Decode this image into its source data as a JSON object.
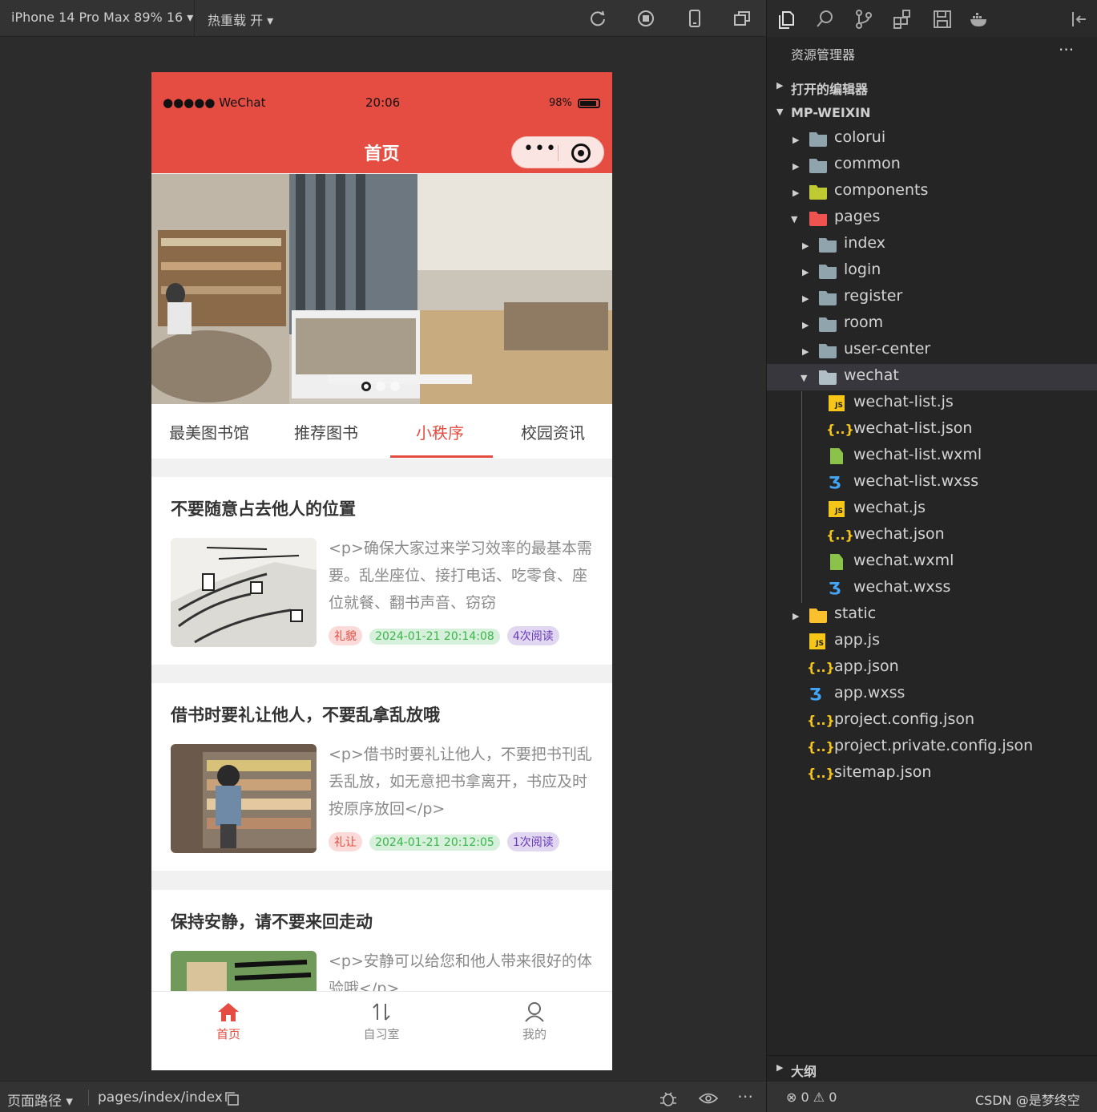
{
  "toolbar": {
    "device": "iPhone 14 Pro Max 89% 16 ▾",
    "hot_reload": "热重载 开 ▾"
  },
  "phone": {
    "status": {
      "signal": "●●●●● WeChat",
      "time": "20:06",
      "battery": "98%"
    },
    "nav_title": "首页",
    "capsule_dots": "•••",
    "tabs": [
      {
        "label": "最美图书馆"
      },
      {
        "label": "推荐图书"
      },
      {
        "label": "小秩序",
        "active": true
      },
      {
        "label": "校园资讯"
      }
    ],
    "cards": [
      {
        "title": "不要随意占去他人的位置",
        "desc": "<p>确保大家过来学习效率的最基本需要。乱坐座位、接打电话、吃零食、座位就餐、翻书声音、窃窃",
        "tags": [
          "礼貌",
          "2024-01-21 20:14:08",
          "4次阅读"
        ]
      },
      {
        "title": "借书时要礼让他人，不要乱拿乱放哦",
        "desc": "<p>借书时要礼让他人，不要把书刊乱丢乱放，如无意把书拿离开，书应及时按原序放回</p>",
        "tags": [
          "礼让",
          "2024-01-21 20:12:05",
          "1次阅读"
        ]
      },
      {
        "title": "保持安静，请不要来回走动",
        "desc": "<p>安静可以给您和他人带来很好的体验哦</p>",
        "tags": []
      }
    ],
    "tabbar": [
      {
        "label": "首页",
        "icon": "home-icon",
        "active": true
      },
      {
        "label": "自习室",
        "icon": "sort-arrows-icon"
      },
      {
        "label": "我的",
        "icon": "user-icon"
      }
    ]
  },
  "bottombar": {
    "path_label": "页面路径 ▾",
    "path_value": "pages/index/index"
  },
  "explorer": {
    "title": "资源管理器",
    "more": "···",
    "open_editors": "打开的编辑器",
    "project": "MP-WEIXIN",
    "tree": [
      {
        "name": "colorui",
        "type": "folder"
      },
      {
        "name": "common",
        "type": "folder"
      },
      {
        "name": "components",
        "type": "folder"
      },
      {
        "name": "pages",
        "type": "folder-open"
      },
      {
        "name": "index",
        "type": "folder"
      },
      {
        "name": "login",
        "type": "folder"
      },
      {
        "name": "register",
        "type": "folder"
      },
      {
        "name": "room",
        "type": "folder"
      },
      {
        "name": "user-center",
        "type": "folder"
      },
      {
        "name": "wechat",
        "type": "folder-open",
        "selected": true
      },
      {
        "name": "wechat-list.js",
        "type": "js"
      },
      {
        "name": "wechat-list.json",
        "type": "json"
      },
      {
        "name": "wechat-list.wxml",
        "type": "wxml"
      },
      {
        "name": "wechat-list.wxss",
        "type": "wxss"
      },
      {
        "name": "wechat.js",
        "type": "js"
      },
      {
        "name": "wechat.json",
        "type": "json"
      },
      {
        "name": "wechat.wxml",
        "type": "wxml"
      },
      {
        "name": "wechat.wxss",
        "type": "wxss"
      },
      {
        "name": "static",
        "type": "folder"
      },
      {
        "name": "app.js",
        "type": "js"
      },
      {
        "name": "app.json",
        "type": "json"
      },
      {
        "name": "app.wxss",
        "type": "wxss"
      },
      {
        "name": "project.config.json",
        "type": "json"
      },
      {
        "name": "project.private.config.json",
        "type": "json"
      },
      {
        "name": "sitemap.json",
        "type": "json"
      }
    ],
    "outline": "大纲",
    "errors": "⊗ 0 ⚠ 0",
    "credit": "CSDN @是梦终空"
  },
  "colors": {
    "accent": "#e54d42",
    "tag_green": "#39b54a",
    "tag_purple": "#6739b6"
  }
}
